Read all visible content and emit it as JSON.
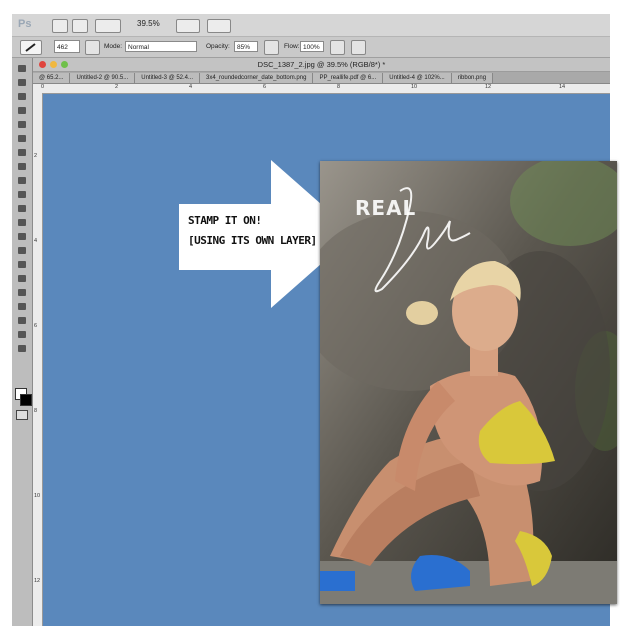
{
  "app": {
    "logo": "Ps",
    "zoom_level": "39.5%"
  },
  "options_bar": {
    "brush_size": "462",
    "mode_label": "Mode:",
    "mode_value": "Normal",
    "opacity_label": "Opacity:",
    "opacity_value": "85%",
    "flow_label": "Flow:",
    "flow_value": "100%"
  },
  "document": {
    "title": "DSC_1387_2.jpg @ 39.5% (RGB/8*) *",
    "tabs": [
      "@ 65.2...",
      "Untitled-2 @ 90.5...",
      "Untitled-3 @ 52.4...",
      "3x4_roundedcorner_date_bottom.png",
      "PP_reallife.pdf @ 6...",
      "Untitled-4 @ 102%...",
      "ribbon.png"
    ]
  },
  "rulers": {
    "h": [
      "0",
      "2",
      "4",
      "6",
      "8",
      "10",
      "12",
      "14"
    ],
    "v": [
      "2",
      "4",
      "6",
      "8",
      "10",
      "12"
    ]
  },
  "callout": {
    "line1": "STAMP IT ON!",
    "line2": "[USING ITS OWN LAYER]"
  },
  "stamp": {
    "word1": "REAL",
    "word2": "life"
  },
  "colors": {
    "canvas": "#5a88bc",
    "close_light": "#e0443e",
    "min_light": "#f0b840",
    "zoom_light": "#6fc04a"
  }
}
